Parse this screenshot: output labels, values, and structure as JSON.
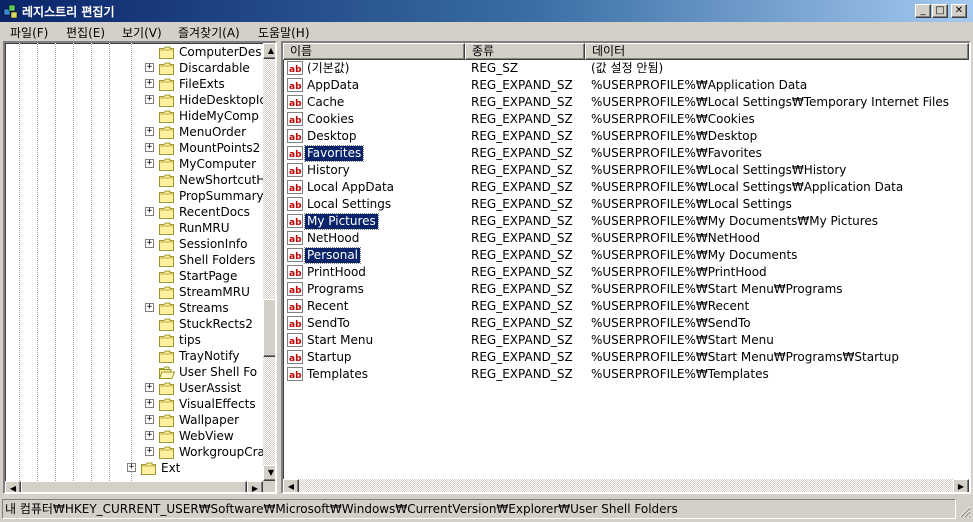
{
  "window": {
    "title": "레지스트리 편집기"
  },
  "menu": [
    "파일(F)",
    "편집(E)",
    "보기(V)",
    "즐겨찾기(A)",
    "도움말(H)"
  ],
  "tree": [
    {
      "label": "ComputerDes",
      "expandable": false
    },
    {
      "label": "Discardable",
      "expandable": true
    },
    {
      "label": "FileExts",
      "expandable": true
    },
    {
      "label": "HideDesktopIc",
      "expandable": true
    },
    {
      "label": "HideMyComp",
      "expandable": false
    },
    {
      "label": "MenuOrder",
      "expandable": true
    },
    {
      "label": "MountPoints2",
      "expandable": true
    },
    {
      "label": "MyComputer",
      "expandable": true
    },
    {
      "label": "NewShortcutH",
      "expandable": false
    },
    {
      "label": "PropSummary",
      "expandable": false
    },
    {
      "label": "RecentDocs",
      "expandable": true
    },
    {
      "label": "RunMRU",
      "expandable": false
    },
    {
      "label": "SessionInfo",
      "expandable": true
    },
    {
      "label": "Shell Folders",
      "expandable": false
    },
    {
      "label": "StartPage",
      "expandable": false
    },
    {
      "label": "StreamMRU",
      "expandable": false
    },
    {
      "label": "Streams",
      "expandable": true
    },
    {
      "label": "StuckRects2",
      "expandable": false
    },
    {
      "label": "tips",
      "expandable": false
    },
    {
      "label": "TrayNotify",
      "expandable": false
    },
    {
      "label": "User Shell Fo",
      "expandable": false,
      "open": true
    },
    {
      "label": "UserAssist",
      "expandable": true
    },
    {
      "label": "VisualEffects",
      "expandable": true
    },
    {
      "label": "Wallpaper",
      "expandable": true
    },
    {
      "label": "WebView",
      "expandable": true
    },
    {
      "label": "WorkgroupCra",
      "expandable": true
    },
    {
      "label": "Ext",
      "expandable": true,
      "level": "parent"
    }
  ],
  "columns": {
    "name": "이름",
    "type": "종류",
    "data": "데이터"
  },
  "values": [
    {
      "name": "(기본값)",
      "type": "REG_SZ",
      "data": "(값 설정 안됨)",
      "selected": false
    },
    {
      "name": "AppData",
      "type": "REG_EXPAND_SZ",
      "data": "%USERPROFILE%₩Application Data",
      "selected": false
    },
    {
      "name": "Cache",
      "type": "REG_EXPAND_SZ",
      "data": "%USERPROFILE%₩Local Settings₩Temporary Internet Files",
      "selected": false
    },
    {
      "name": "Cookies",
      "type": "REG_EXPAND_SZ",
      "data": "%USERPROFILE%₩Cookies",
      "selected": false
    },
    {
      "name": "Desktop",
      "type": "REG_EXPAND_SZ",
      "data": "%USERPROFILE%₩Desktop",
      "selected": false
    },
    {
      "name": "Favorites",
      "type": "REG_EXPAND_SZ",
      "data": "%USERPROFILE%₩Favorites",
      "selected": true
    },
    {
      "name": "History",
      "type": "REG_EXPAND_SZ",
      "data": "%USERPROFILE%₩Local Settings₩History",
      "selected": false
    },
    {
      "name": "Local AppData",
      "type": "REG_EXPAND_SZ",
      "data": "%USERPROFILE%₩Local Settings₩Application Data",
      "selected": false
    },
    {
      "name": "Local Settings",
      "type": "REG_EXPAND_SZ",
      "data": "%USERPROFILE%₩Local Settings",
      "selected": false
    },
    {
      "name": "My Pictures",
      "type": "REG_EXPAND_SZ",
      "data": "%USERPROFILE%₩My Documents₩My Pictures",
      "selected": true
    },
    {
      "name": "NetHood",
      "type": "REG_EXPAND_SZ",
      "data": "%USERPROFILE%₩NetHood",
      "selected": false
    },
    {
      "name": "Personal",
      "type": "REG_EXPAND_SZ",
      "data": "%USERPROFILE%₩My Documents",
      "selected": true
    },
    {
      "name": "PrintHood",
      "type": "REG_EXPAND_SZ",
      "data": "%USERPROFILE%₩PrintHood",
      "selected": false
    },
    {
      "name": "Programs",
      "type": "REG_EXPAND_SZ",
      "data": "%USERPROFILE%₩Start Menu₩Programs",
      "selected": false
    },
    {
      "name": "Recent",
      "type": "REG_EXPAND_SZ",
      "data": "%USERPROFILE%₩Recent",
      "selected": false
    },
    {
      "name": "SendTo",
      "type": "REG_EXPAND_SZ",
      "data": "%USERPROFILE%₩SendTo",
      "selected": false
    },
    {
      "name": "Start Menu",
      "type": "REG_EXPAND_SZ",
      "data": "%USERPROFILE%₩Start Menu",
      "selected": false
    },
    {
      "name": "Startup",
      "type": "REG_EXPAND_SZ",
      "data": "%USERPROFILE%₩Start Menu₩Programs₩Startup",
      "selected": false
    },
    {
      "name": "Templates",
      "type": "REG_EXPAND_SZ",
      "data": "%USERPROFILE%₩Templates",
      "selected": false
    }
  ],
  "status": {
    "path": "내 컴퓨터₩HKEY_CURRENT_USER₩Software₩Microsoft₩Windows₩CurrentVersion₩Explorer₩User Shell Folders"
  },
  "colors": {
    "title_start": "#0a246a",
    "title_end": "#a6caf0",
    "selection": "#0a246a",
    "face": "#d4d0c8"
  },
  "icons": {
    "value": "ab-string-icon",
    "folder": "folder-icon",
    "app": "registry-editor-icon"
  }
}
